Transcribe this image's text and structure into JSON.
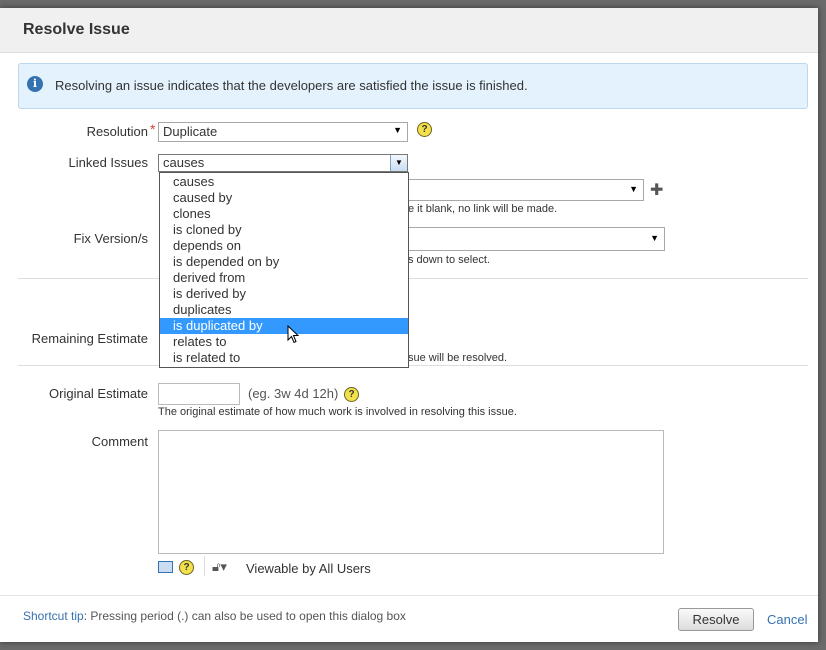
{
  "dialog": {
    "title": "Resolve Issue",
    "info_message": "Resolving an issue indicates that the developers are satisfied the issue is finished."
  },
  "form": {
    "resolution_label": "Resolution",
    "resolution_value": "Duplicate",
    "linked_issues_label": "Linked Issues",
    "linked_issues_value": "causes",
    "linked_hint_partial": "e it blank, no link will be made.",
    "fix_version_label": "Fix Version/s",
    "fix_hint_partial": "s down to select.",
    "remaining_estimate_label": "Remaining Estimate",
    "remaining_hint_partial": "sue will be resolved.",
    "original_estimate_label": "Original Estimate",
    "original_estimate_value": "",
    "original_estimate_example": "(eg. 3w 4d 12h)",
    "original_estimate_hint": "The original estimate of how much work is involved in resolving this issue.",
    "comment_label": "Comment",
    "comment_value": "",
    "viewable_label": "Viewable by All Users"
  },
  "dropdown_options": [
    "causes",
    "caused by",
    "clones",
    "is cloned by",
    "depends on",
    "is depended on by",
    "derived from",
    "is derived by",
    "duplicates",
    "is duplicated by",
    "relates to",
    "is related to"
  ],
  "dropdown_highlighted": "is duplicated by",
  "footer": {
    "shortcut_link": "Shortcut tip",
    "shortcut_text": ": Pressing period (.) can also be used to open this dialog box",
    "resolve_button": "Resolve",
    "cancel_link": "Cancel"
  },
  "colors": {
    "accent": "#3572b0",
    "highlight": "#3399ff",
    "info_bg": "#e4f2fd"
  }
}
